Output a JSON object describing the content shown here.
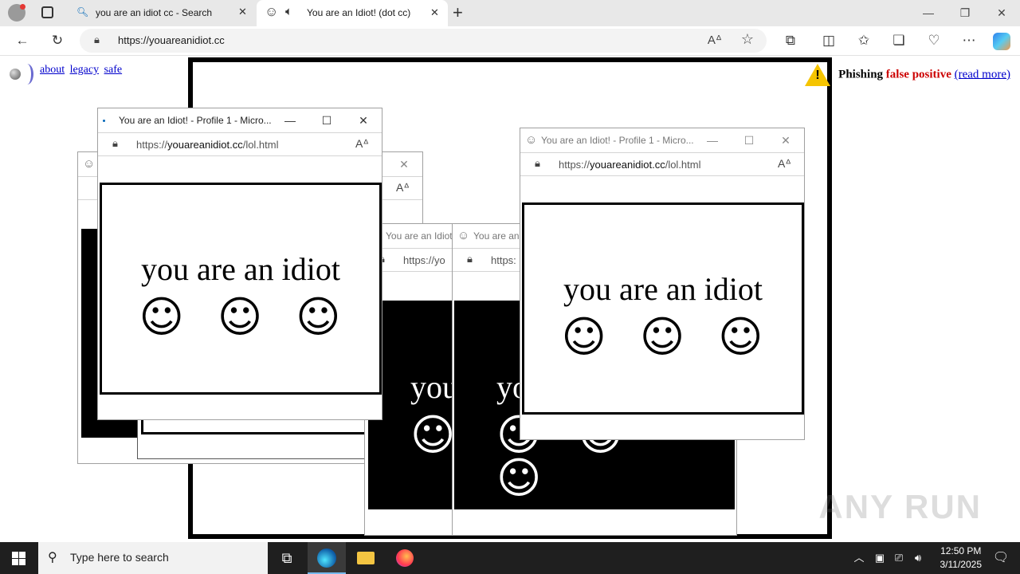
{
  "browser": {
    "tabs": [
      {
        "label": "you are an idiot cc - Search",
        "icon": "search-icon"
      },
      {
        "label": "You are an Idiot! (dot cc)",
        "icon": "smiley-icon",
        "audio": "speaker-icon"
      }
    ],
    "url": "https://youareanidiot.cc",
    "window_controls": {
      "minimize": "—",
      "restore": "❐",
      "close": "✕"
    }
  },
  "page": {
    "links": [
      "about",
      "legacy",
      "safe"
    ],
    "banner": {
      "prefix": "Phishing",
      "highlight": "false positive",
      "link": "(read more)"
    }
  },
  "popups": [
    {
      "title": "You are an Idiot! - Profile 1 - Micro...",
      "url_host": "youareanidiot.cc",
      "url_path": "/lol.html",
      "url_scheme": "https://"
    },
    {
      "title": "You are an Idiot! - Profile 1 - Micro...",
      "url_host": "youareanidiot.cc",
      "url_path": "/lol.html",
      "url_scheme": "https://"
    },
    {
      "title": "You are an Idiot!",
      "url_partial": "https://yo"
    },
    {
      "title": "You are an",
      "url_partial": "https:"
    }
  ],
  "content": {
    "text": "you are an idiot",
    "text_partial_1": "you",
    "text_partial_2": "yo",
    "smiley": "☺"
  },
  "taskbar": {
    "search_placeholder": "Type here to search",
    "time": "12:50 PM",
    "date": "3/11/2025"
  },
  "watermark": "ANY RUN"
}
